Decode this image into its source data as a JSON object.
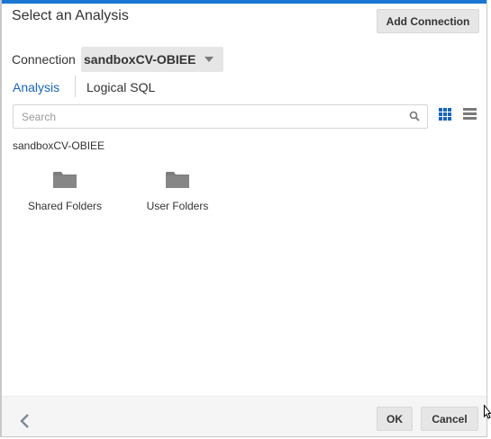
{
  "dialog": {
    "title": "Select an Analysis",
    "add_connection_label": "Add Connection",
    "accent_color": "#1976d2"
  },
  "connection": {
    "label": "Connection",
    "selected": "sandboxCV-OBIEE"
  },
  "tabs": [
    {
      "label": "Analysis",
      "active": true
    },
    {
      "label": "Logical SQL",
      "active": false
    }
  ],
  "search": {
    "placeholder": "Search",
    "value": "",
    "icon": "search-icon"
  },
  "view_toggles": [
    {
      "icon": "grid-view-icon",
      "active": true
    },
    {
      "icon": "list-view-icon",
      "active": false
    }
  ],
  "breadcrumb": "sandboxCV-OBIEE",
  "folders": [
    {
      "label": "Shared Folders",
      "icon": "folder-icon"
    },
    {
      "label": "User Folders",
      "icon": "folder-icon"
    }
  ],
  "footer": {
    "back_icon": "chevron-left-icon",
    "ok_label": "OK",
    "cancel_label": "Cancel"
  }
}
